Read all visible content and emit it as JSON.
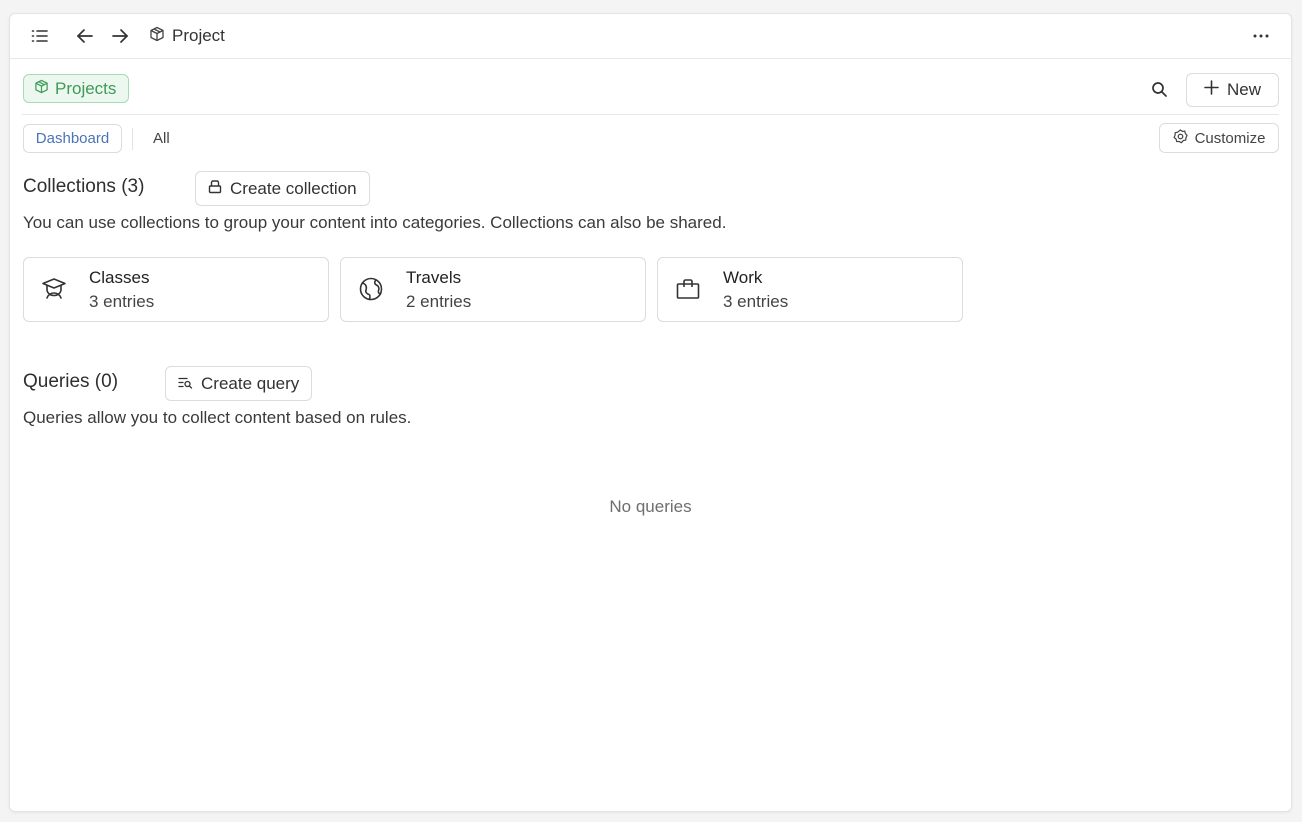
{
  "topbar": {
    "menu_icon": "list-icon",
    "back_icon": "arrow-left-icon",
    "forward_icon": "arrow-right-icon",
    "crumb_icon": "cube-icon",
    "title": "Project",
    "more_icon": "more-horizontal-icon"
  },
  "header": {
    "pill_label": "Projects",
    "pill_icon": "cube-icon",
    "search_icon": "search-icon",
    "new_label": "New"
  },
  "tabs": {
    "dashboard": "Dashboard",
    "all": "All",
    "customize": "Customize"
  },
  "collections": {
    "title": "Collections (3)",
    "create_label": "Create collection",
    "description": "You can use collections to group your content into categories. Collections can also be shared.",
    "items": [
      {
        "name": "Classes",
        "count": "3 entries",
        "icon": "graduation-cap-icon"
      },
      {
        "name": "Travels",
        "count": "2 entries",
        "icon": "globe-icon"
      },
      {
        "name": "Work",
        "count": "3 entries",
        "icon": "briefcase-icon"
      }
    ]
  },
  "queries": {
    "title": "Queries (0)",
    "create_label": "Create query",
    "description": "Queries allow you to collect content based on rules.",
    "empty_text": "No queries"
  },
  "colors": {
    "accent_green": "#3e9a57",
    "accent_blue": "#4a74b8",
    "border": "#dcdcdc"
  }
}
